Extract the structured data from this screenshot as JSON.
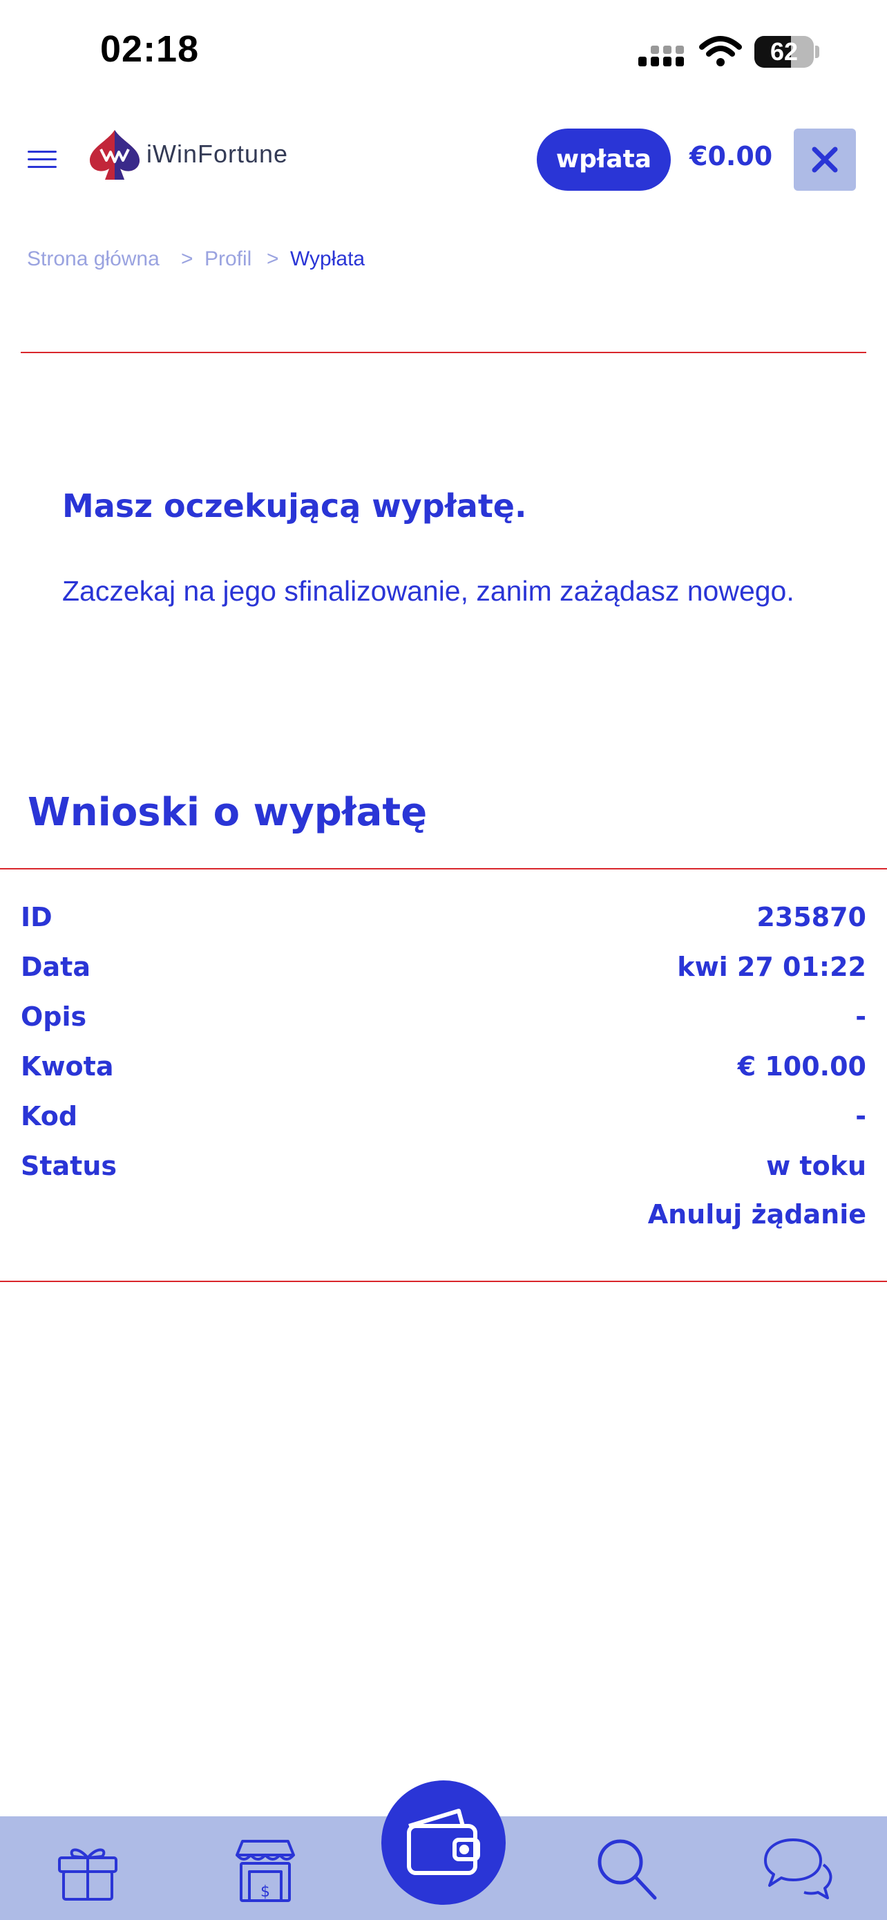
{
  "status_bar": {
    "time": "02:18",
    "battery_percent": 62,
    "battery_label": "62",
    "icons": [
      "cellular-signal-icon",
      "wifi-icon",
      "battery-icon"
    ]
  },
  "header": {
    "brand": "iWinFortune",
    "deposit_label": "wpłata",
    "balance": "€0.00",
    "icons": [
      "hamburger-menu-icon",
      "brand-logo-icon",
      "close-icon"
    ]
  },
  "breadcrumb": {
    "items": [
      "Strona główna",
      "Profil",
      "Wypłata"
    ],
    "separator": ">"
  },
  "notice": {
    "title": "Masz oczekującą wypłatę.",
    "text": "Zaczekaj na jego sfinalizowanie, zanim zażądasz nowego."
  },
  "withdrawals": {
    "title": "Wnioski o wypłatę",
    "rows": [
      {
        "label": "ID",
        "value": "235870"
      },
      {
        "label": "Data",
        "value": "kwi 27 01:22"
      },
      {
        "label": "Opis",
        "value": "-"
      },
      {
        "label": "Kwota",
        "value": "€ 100.00"
      },
      {
        "label": "Kod",
        "value": "-"
      },
      {
        "label": "Status",
        "value": "w toku"
      }
    ],
    "cancel_label": "Anuluj żądanie"
  },
  "bottom_nav": {
    "items": [
      "gift-icon",
      "shop-icon",
      "wallet-icon",
      "search-icon",
      "chat-icon"
    ],
    "active": "wallet-icon"
  },
  "colors": {
    "accent": "#2a35d6",
    "nav_background": "#aebbe6",
    "divider": "#d9262c"
  }
}
